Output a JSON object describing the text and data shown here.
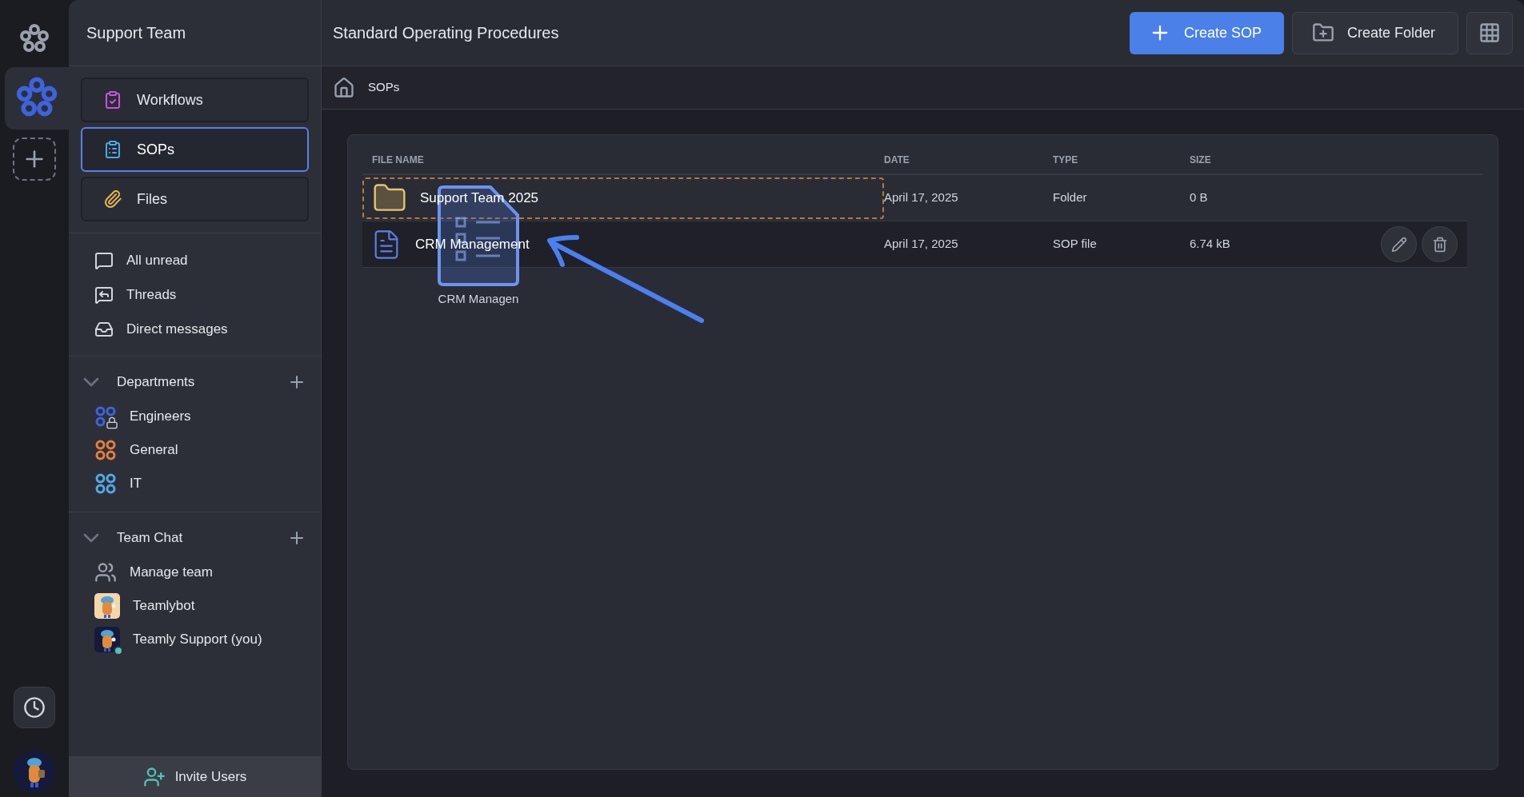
{
  "sidebar": {
    "title": "Support Team",
    "nav": [
      {
        "kind": "workflows",
        "label": "Workflows",
        "selected": false
      },
      {
        "kind": "sops",
        "label": "SOPs",
        "selected": true
      },
      {
        "kind": "files",
        "label": "Files",
        "selected": false
      }
    ],
    "links": [
      {
        "kind": "unread",
        "label": "All unread"
      },
      {
        "kind": "threads",
        "label": "Threads"
      },
      {
        "kind": "direct",
        "label": "Direct messages"
      }
    ],
    "sections": [
      {
        "title": "Departments",
        "expanded": true,
        "items": [
          {
            "kind": "department",
            "label": "Engineers",
            "color": "#3d63dd",
            "locked": true
          },
          {
            "kind": "department",
            "label": "General",
            "color": "#e57f3c",
            "locked": false
          },
          {
            "kind": "department",
            "label": "IT",
            "color": "#52a9e6",
            "locked": false
          }
        ]
      },
      {
        "title": "Team Chat",
        "expanded": true,
        "items": [
          {
            "kind": "team",
            "label": "Manage team"
          },
          {
            "kind": "bot",
            "label": "Teamlybot"
          },
          {
            "kind": "user",
            "label": "Teamly Support (you)",
            "online": true
          }
        ]
      }
    ],
    "invite": "Invite Users"
  },
  "rail": {
    "workspaces": [
      {
        "selected": false
      },
      {
        "selected": true
      }
    ]
  },
  "header": {
    "title": "Standard Operating Procedures",
    "buttons": [
      {
        "kind": "primary",
        "label": "Create SOP"
      },
      {
        "kind": "folder",
        "label": "Create Folder"
      }
    ]
  },
  "breadcrumb": "SOPs",
  "table": {
    "columns": [
      "FILE NAME",
      "DATE",
      "TYPE",
      "SIZE"
    ],
    "rows": [
      {
        "kind": "folder",
        "name": "Support Team 2025",
        "date": "April 17, 2025",
        "type": "Folder",
        "size": "0 B",
        "drop_target": true,
        "hovered": false
      },
      {
        "kind": "sop",
        "name": "CRM Management",
        "date": "April 17, 2025",
        "type": "SOP file",
        "size": "6.74 kB",
        "drop_target": false,
        "hovered": true
      }
    ]
  },
  "drag_ghost": {
    "label": "CRM Managen"
  }
}
